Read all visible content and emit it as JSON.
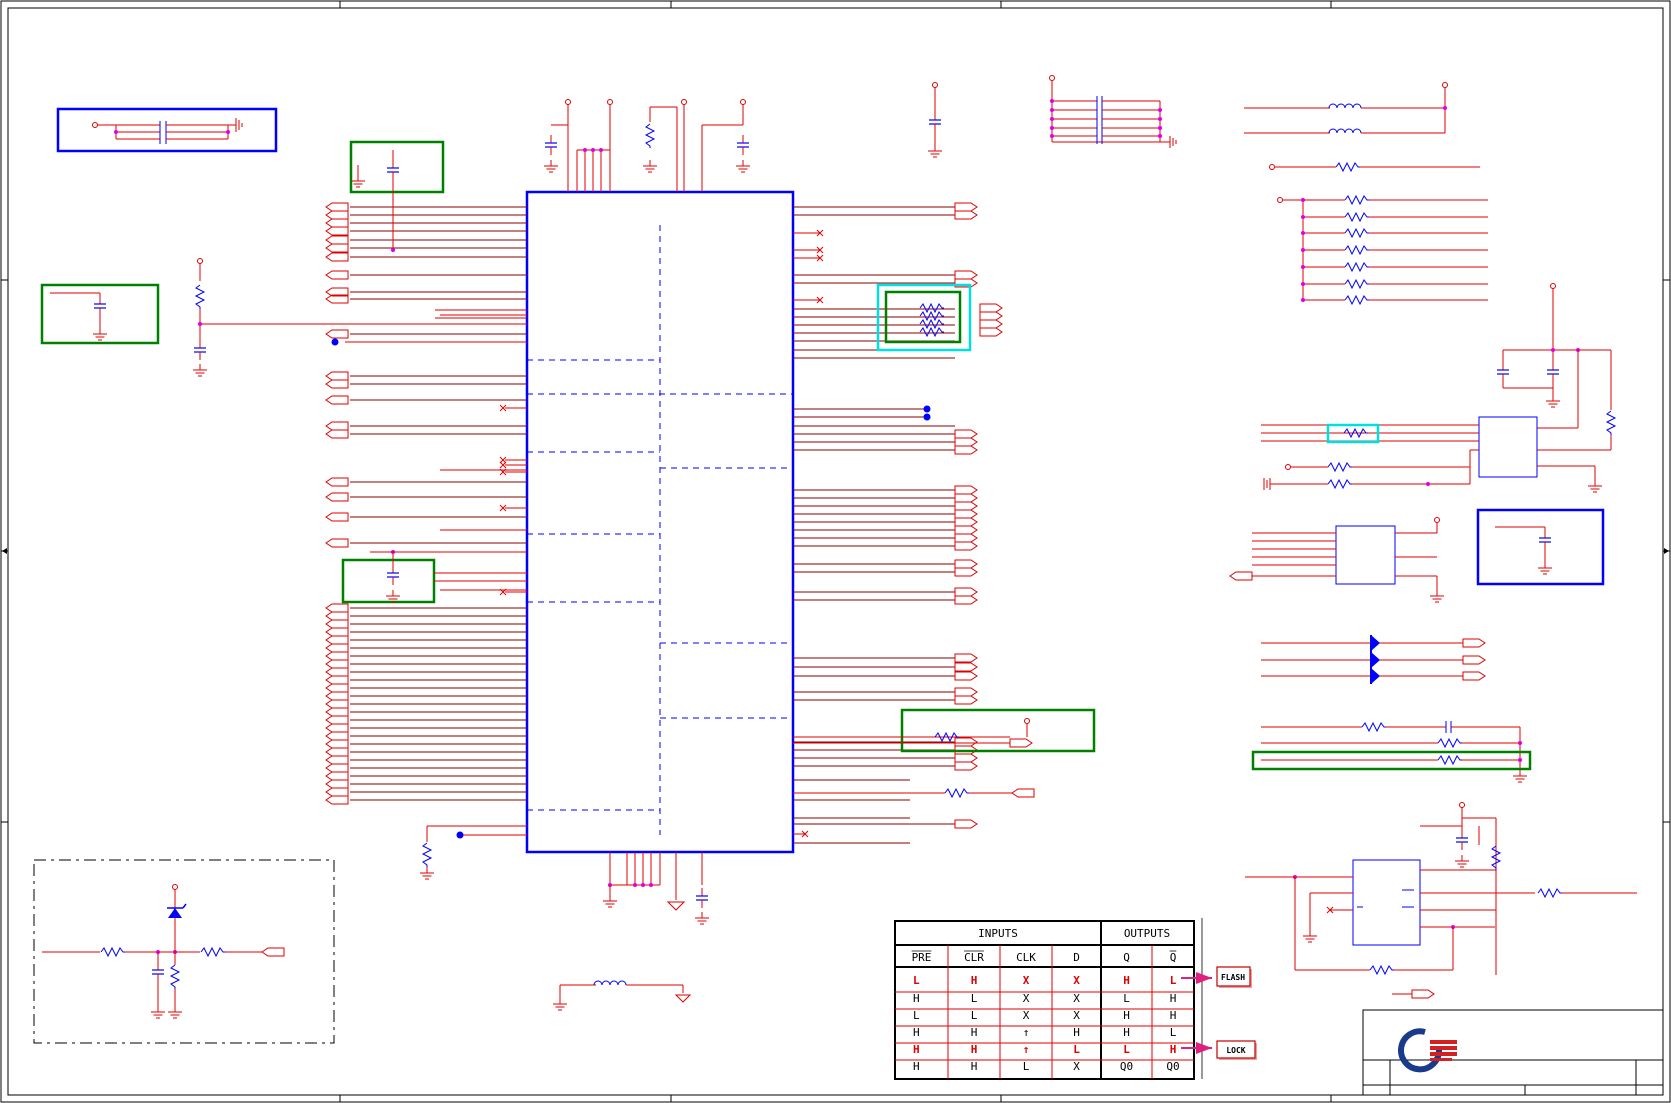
{
  "truth_table": {
    "group_headers": [
      "INPUTS",
      "OUTPUTS"
    ],
    "columns": [
      "PRE",
      "CLR",
      "CLK",
      "D",
      "Q",
      "Q"
    ],
    "rows": [
      [
        "L",
        "H",
        "X",
        "X",
        "H",
        "L"
      ],
      [
        "H",
        "L",
        "X",
        "X",
        "L",
        "H"
      ],
      [
        "L",
        "L",
        "X",
        "X",
        "H",
        "H"
      ],
      [
        "H",
        "H",
        "↑",
        "H",
        "H",
        "L"
      ],
      [
        "H",
        "H",
        "↑",
        "L",
        "L",
        "H"
      ],
      [
        "H",
        "H",
        "L",
        "X",
        "Q0",
        "Q0"
      ]
    ],
    "highlighted_rows": [
      0,
      4
    ]
  },
  "callouts": {
    "flash": "FLASH",
    "lock": "LOCK"
  },
  "colors": {
    "wire": "#e00000",
    "bus": "#880000",
    "component": "#0000ff",
    "highlight_green": "#008000",
    "highlight_cyan": "#00e0e0",
    "junction": "#e000e0",
    "callout_arrow": "#e0207f",
    "logo_blue": "#1a3a8c",
    "logo_red": "#d42020"
  },
  "icons": [
    "company-logo-icon",
    "ground-icon",
    "capacitor-icon",
    "resistor-icon",
    "inductor-icon",
    "diode-icon",
    "zener-diode-icon",
    "off-page-connector-icon"
  ]
}
